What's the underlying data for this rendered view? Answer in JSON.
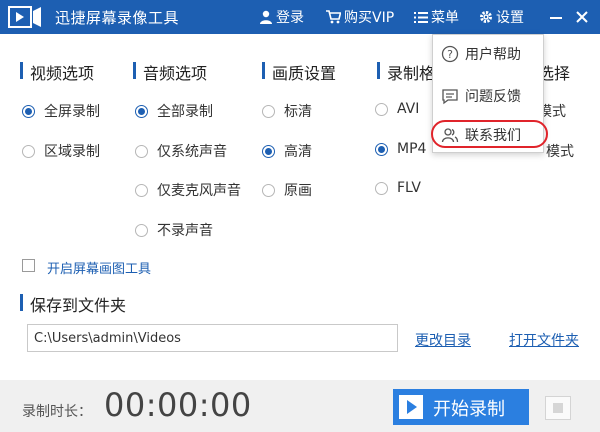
{
  "titlebar": {
    "app_title": "迅捷屏幕录像工具",
    "login": "登录",
    "buy_vip": "购买VIP",
    "menu": "菜单",
    "settings": "设置"
  },
  "sections": {
    "video": "视频选项",
    "audio": "音频选项",
    "quality": "画质设置",
    "format": "录制格",
    "mode": "选择"
  },
  "video_options": [
    "全屏录制",
    "区域录制"
  ],
  "audio_options": [
    "全部录制",
    "仅系统声音",
    "仅麦克风声音",
    "不录声音"
  ],
  "quality_options": [
    "标清",
    "高清",
    "原画"
  ],
  "format_options": [
    "AVI",
    "MP4",
    "FLV"
  ],
  "mode_options": [
    "模式",
    "模式"
  ],
  "selected": {
    "video": "全屏录制",
    "audio": "全部录制",
    "quality": "高清",
    "format": "MP4"
  },
  "screen_draw_tool": "开启屏幕画图工具",
  "save_section": "保存到文件夹",
  "save_path": "C:\\Users\\admin\\Videos",
  "change_dir": "更改目录",
  "open_folder": "打开文件夹",
  "record_label": "录制时长：",
  "record_time": "00:00:00",
  "start_record": "开始录制",
  "menu_dropdown": [
    "用户帮助",
    "问题反馈",
    "联系我们"
  ],
  "colors": {
    "titlebar": "#1d5fb2",
    "accent": "#2b7fe0",
    "highlight": "#e0242b"
  }
}
